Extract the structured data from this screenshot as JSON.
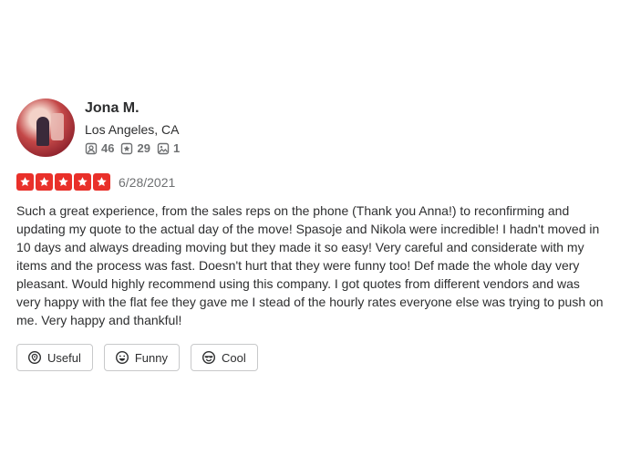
{
  "reviewer": {
    "name": "Jona M.",
    "location": "Los Angeles, CA",
    "stats": {
      "friends": "46",
      "reviews": "29",
      "photos": "1"
    }
  },
  "review": {
    "rating": 5,
    "max_rating": 5,
    "date": "6/28/2021",
    "text": "Such a great experience, from the sales reps on the phone (Thank you Anna!) to reconfirming and updating my quote to the actual day of the move! Spasoje and Nikola were incredible! I hadn't moved in 10 days and always dreading moving but they made it so easy! Very careful and considerate with my items and the process was fast. Doesn't hurt that they were funny too! Def made the whole day very pleasant. Would highly recommend using this company. I got quotes from different vendors and was very happy with the flat fee they gave me I stead of the hourly rates everyone else was trying to push on me. Very happy and thankful!"
  },
  "reactions": {
    "useful_label": "Useful",
    "funny_label": "Funny",
    "cool_label": "Cool"
  },
  "colors": {
    "star_red": "#e9302a",
    "text": "#2d2e2f",
    "muted": "#6e7072",
    "border": "#c8c9ca"
  },
  "icons": [
    "friends-icon",
    "review-star-icon",
    "photo-icon",
    "star-icon",
    "useful-icon",
    "funny-icon",
    "cool-icon"
  ]
}
